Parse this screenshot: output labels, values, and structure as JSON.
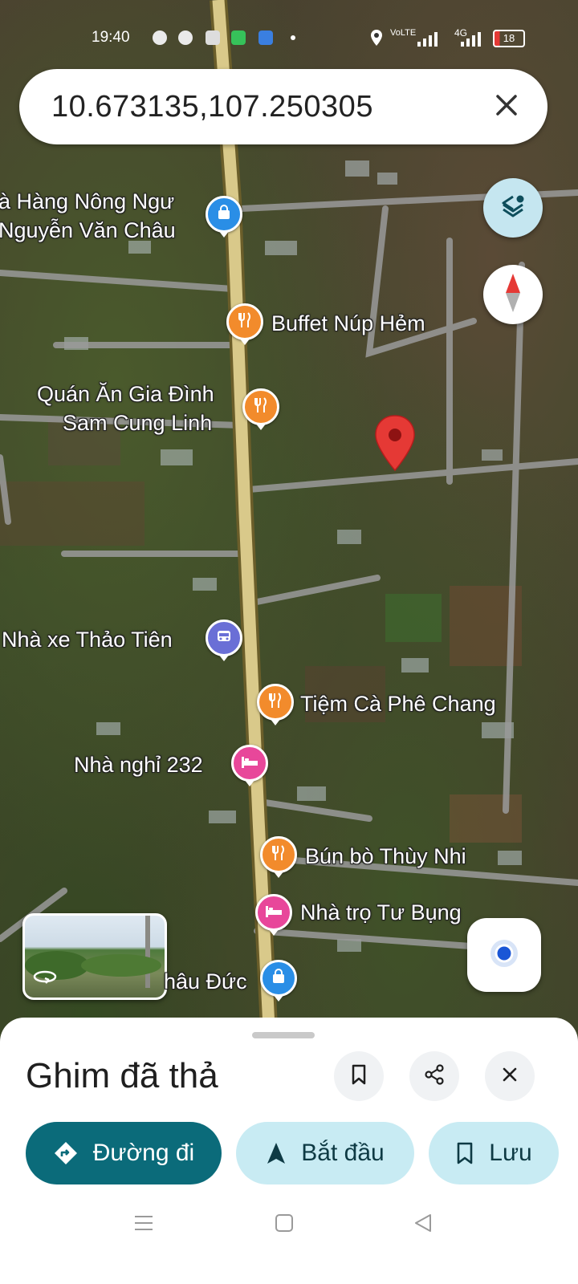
{
  "status_bar": {
    "time": "19:40",
    "network_1": "VoLTE",
    "network_2": "4G",
    "battery": "18"
  },
  "search": {
    "query": "10.673135,107.250305"
  },
  "map": {
    "labels": {
      "nong_ngu_line1": "à Hàng Nông Ngư",
      "nong_ngu_line2": "Nguyễn Văn Châu",
      "buffet": "Buffet Núp Hẻm",
      "gia_dinh_line1": "Quán Ăn Gia Đình",
      "gia_dinh_line2": "Sam Cung Linh",
      "nha_xe": "Nhà xe Thảo Tiên",
      "tiem_ca_phe": "Tiệm Cà Phê Chang",
      "nha_nghi": "Nhà nghỉ 232",
      "bun_bo": "Bún bò Thùy Nhi",
      "nha_tro": "Nhà trọ Tư Bụng",
      "chau_duc": "hâu Đức"
    },
    "poi_icons": {
      "shopping": "shopping-bag-icon",
      "food": "fork-knife-icon",
      "transit": "bus-icon",
      "lodging": "bed-icon"
    },
    "colors": {
      "food": "#f28b2c",
      "shopping": "#2a8ee6",
      "transit": "#6a6fd6",
      "lodging": "#e8479a",
      "pin": "#e53935"
    }
  },
  "sheet": {
    "title": "Ghim đã thả",
    "directions_label": "Đường đi",
    "start_label": "Bắt đầu",
    "save_label": "Lưu"
  }
}
